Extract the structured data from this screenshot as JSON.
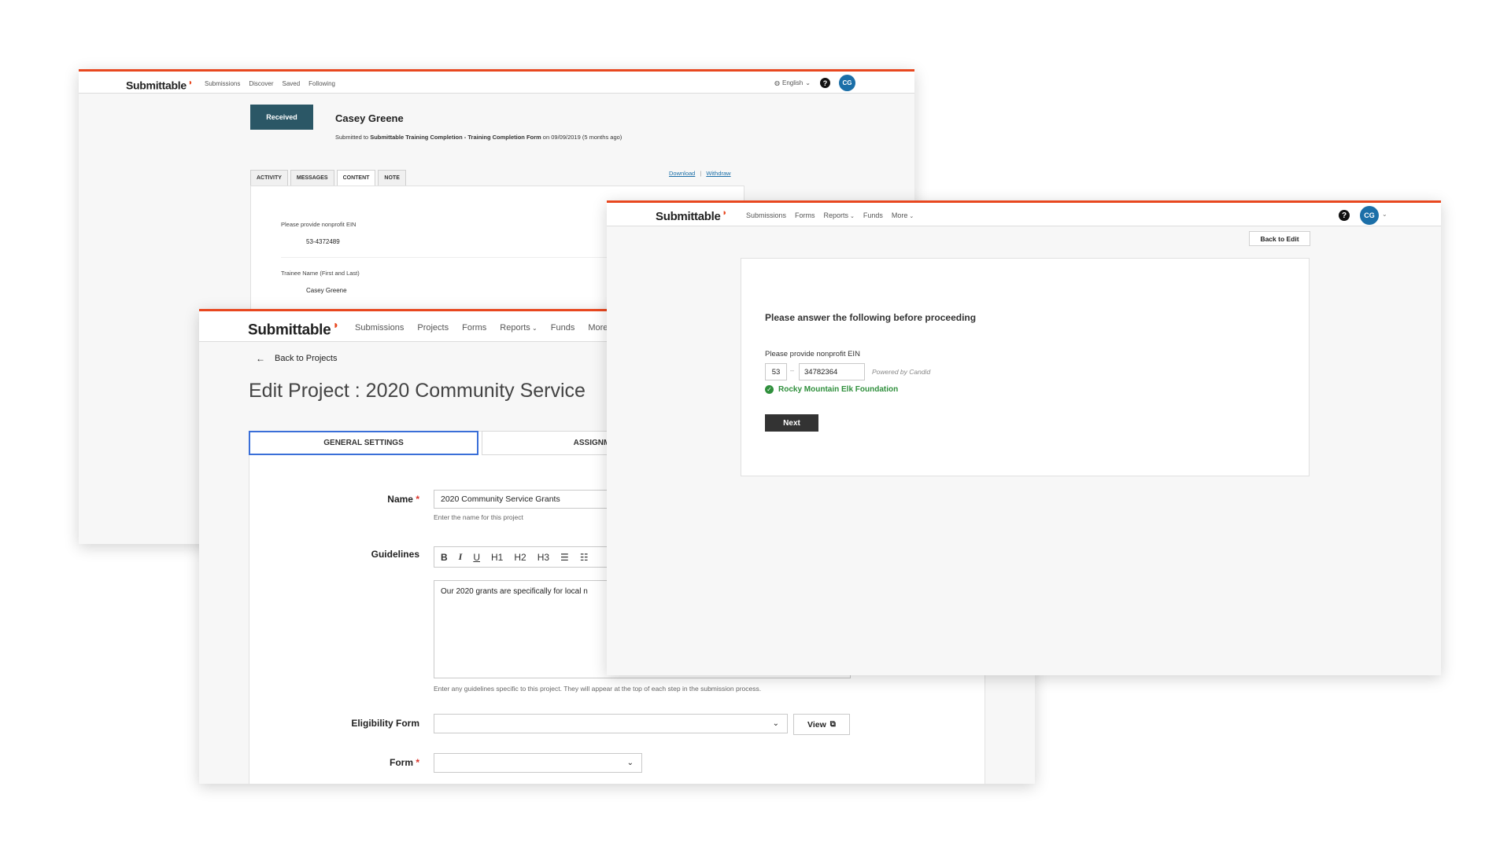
{
  "submission_view": {
    "logo": "Submittable",
    "nav": [
      "Submissions",
      "Discover",
      "Saved",
      "Following"
    ],
    "language": "English",
    "avatar_initials": "CG",
    "status_badge": "Received",
    "submitter_name": "Casey Greene",
    "submitted_prefix": "Submitted to",
    "submitted_form": "Submittable Training Completion - Training Completion Form",
    "submitted_suffix": "on 09/09/2019 (5 months ago)",
    "tabs": [
      "ACTIVITY",
      "MESSAGES",
      "CONTENT",
      "NOTE"
    ],
    "active_tab": "CONTENT",
    "download_link": "Download",
    "separator": "|",
    "withdraw_link": "Withdraw",
    "fields": [
      {
        "label": "Please provide nonprofit EIN",
        "value": "53-4372489"
      },
      {
        "label": "Trainee Name (First and Last)",
        "value": "Casey Greene"
      }
    ]
  },
  "edit_project": {
    "logo": "Submittable",
    "nav": [
      "Submissions",
      "Projects",
      "Forms",
      "Reports",
      "Funds",
      "More"
    ],
    "back_link": "Back to Projects",
    "page_title": "Edit Project : 2020 Community Service",
    "tabs": {
      "general": "GENERAL SETTINGS",
      "assignment": "ASSIGNMENT"
    },
    "name_label": "Name",
    "name_value": "2020 Community Service Grants",
    "name_hint": "Enter the name for this project",
    "guidelines_label": "Guidelines",
    "toolbar": [
      "B",
      "I",
      "U",
      "H1",
      "H2",
      "H3"
    ],
    "guidelines_text": "Our 2020 grants are specifically for local n",
    "guidelines_hint": "Enter any guidelines specific to this project. They will appear at the top of each step in the submission process.",
    "eligibility_label": "Eligibility Form",
    "view_button": "View",
    "form_label": "Form",
    "required_mark": "*"
  },
  "eligibility": {
    "logo": "Submittable",
    "nav": [
      "Submissions",
      "Forms",
      "Reports",
      "Funds",
      "More"
    ],
    "avatar_initials": "CG",
    "back_button": "Back to Edit",
    "heading": "Please answer the following before proceeding",
    "ein_label": "Please provide nonprofit EIN",
    "ein_prefix": "53",
    "ein_dash": "–",
    "ein_number": "34782364",
    "powered_by": "Powered by Candid",
    "org_name": "Rocky Mountain Elk Foundation",
    "next_button": "Next"
  },
  "colors": {
    "accent": "#e8471f",
    "badge": "#2b5766",
    "avatar": "#1b6fa8",
    "success": "#2f8f3c",
    "focus": "#3a6fd8"
  }
}
